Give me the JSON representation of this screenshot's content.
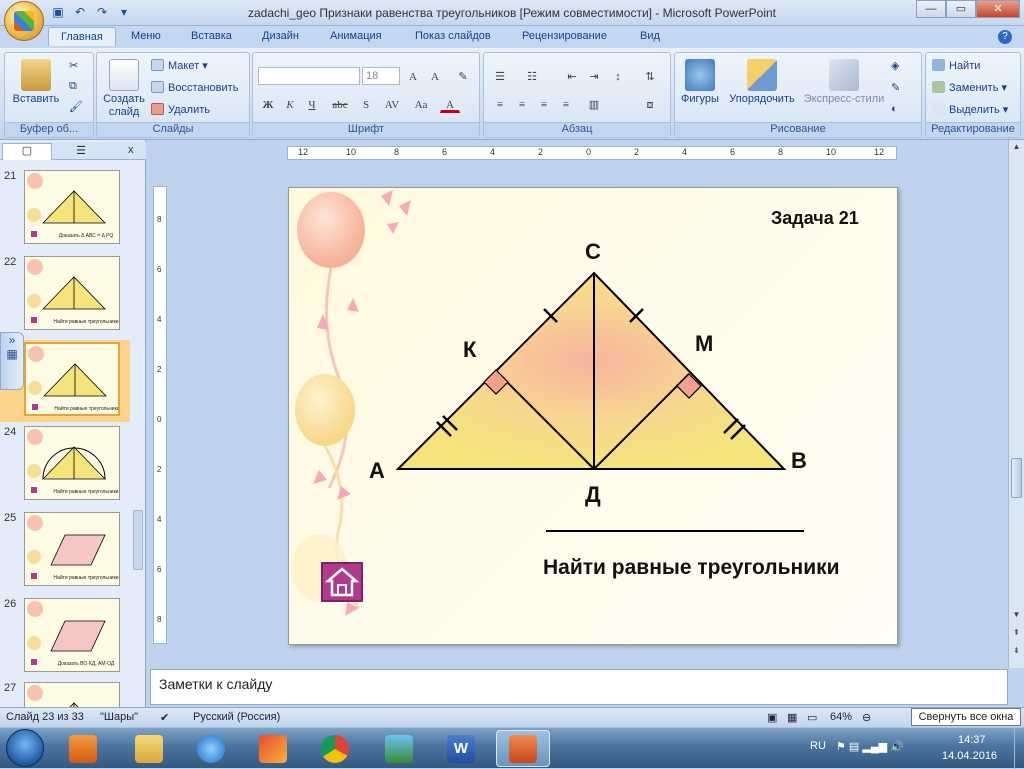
{
  "window": {
    "title": "zadachi_geo Признаки равенства треугольников [Режим совместимости] - Microsoft PowerPoint",
    "min": "—",
    "max": "▭",
    "close": "✕"
  },
  "tabs": [
    "Главная",
    "Меню",
    "Вставка",
    "Дизайн",
    "Анимация",
    "Показ слайдов",
    "Рецензирование",
    "Вид"
  ],
  "ribbon": {
    "clipboard": {
      "paste": "Вставить",
      "label": "Буфер об..."
    },
    "slides": {
      "create": "Создать слайд",
      "layout": "Макет",
      "reset": "Восстановить",
      "delete": "Удалить",
      "label": "Слайды"
    },
    "font": {
      "size": "18",
      "label": "Шрифт"
    },
    "paragraph": {
      "label": "Абзац"
    },
    "drawing": {
      "shapes": "Фигуры",
      "arrange": "Упорядочить",
      "styles": "Экспресс-стили",
      "label": "Рисование"
    },
    "editing": {
      "find": "Найти",
      "replace": "Заменить",
      "select": "Выделить",
      "label": "Редактирование"
    }
  },
  "thumbnails": [
    {
      "num": "21",
      "caption": "Доказать Δ ABC = Δ PQ"
    },
    {
      "num": "22",
      "caption": "Найти равные треугольники"
    },
    {
      "num": "23",
      "caption": "Найти равные треугольники"
    },
    {
      "num": "24",
      "caption": "Найти равные треугольники"
    },
    {
      "num": "25",
      "caption": "Найти равные треугольники"
    },
    {
      "num": "26",
      "caption": "Доказать ВО·КД, АМ·ОД"
    },
    {
      "num": "27",
      "caption": ""
    }
  ],
  "slide": {
    "task": "Задача 21",
    "labels": {
      "A": "А",
      "B": "В",
      "C": "С",
      "D": "Д",
      "K": "К",
      "M": "М"
    },
    "prompt": "Найти равные треугольники"
  },
  "ruler": {
    "ticks": [
      "12",
      "10",
      "8",
      "6",
      "4",
      "2",
      "0",
      "2",
      "4",
      "6",
      "8",
      "10",
      "12"
    ],
    "vticks": [
      "8",
      "6",
      "4",
      "2",
      "0",
      "2",
      "4",
      "6",
      "8"
    ]
  },
  "notes": "Заметки к слайду",
  "status": {
    "slide": "Слайд 23 из 33",
    "theme": "\"Шары\"",
    "lang": "Русский (Россия)",
    "zoom": "64%",
    "tooltip": "Свернуть все окна"
  },
  "tray": {
    "lang": "RU",
    "time": "14:37",
    "date": "14.04.2016"
  },
  "colors": {
    "triangle": "#f5e47c",
    "right_angle": "#f2a08a",
    "home": "#b03a8e"
  }
}
